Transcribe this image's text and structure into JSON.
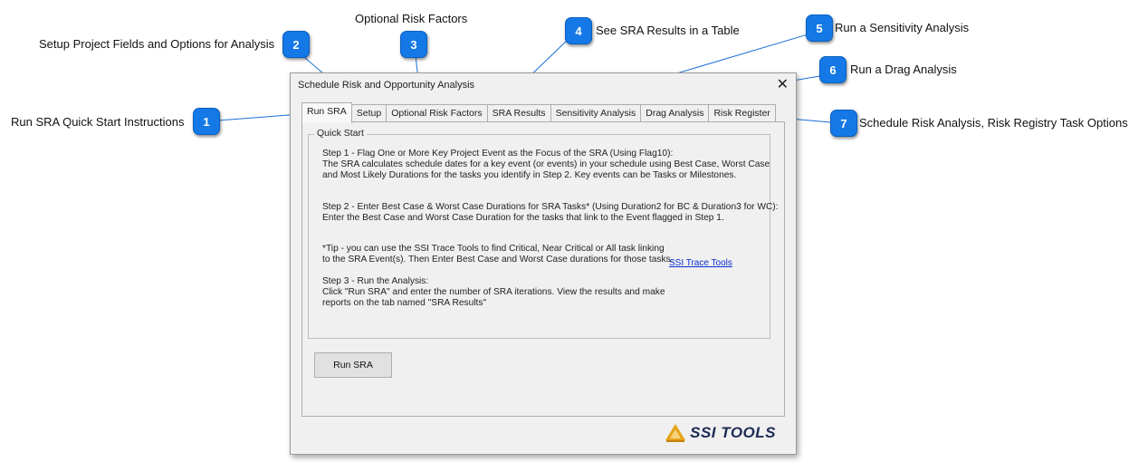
{
  "callouts": [
    {
      "num": "1",
      "text": "Run SRA Quick Start Instructions"
    },
    {
      "num": "2",
      "text": "Setup Project Fields and Options for Analysis"
    },
    {
      "num": "3",
      "text": "Optional Risk Factors"
    },
    {
      "num": "4",
      "text": "See SRA Results in a Table"
    },
    {
      "num": "5",
      "text": "Run a Sensitivity Analysis"
    },
    {
      "num": "6",
      "text": "Run a Drag Analysis"
    },
    {
      "num": "7",
      "text": "Schedule Risk Analysis, Risk Registry Task Options"
    }
  ],
  "dialog": {
    "title": "Schedule Risk and Opportunity Analysis",
    "close": "✕",
    "tabs": [
      "Run SRA",
      "Setup",
      "Optional Risk Factors",
      "SRA Results",
      "Sensitivity Analysis",
      "Drag Analysis",
      "Risk Register"
    ],
    "group_title": "Quick Start",
    "step1": [
      "Step 1 - Flag One or More Key Project Event as the Focus of the SRA (Using Flag10):",
      "The SRA calculates schedule dates for a key event (or events) in your schedule using Best Case, Worst Case",
      "and Most Likely Durations for the tasks you identify in Step 2.  Key events can be Tasks or Milestones."
    ],
    "step2": [
      "Step 2 - Enter Best Case & Worst Case Durations for SRA Tasks* (Using Duration2 for BC & Duration3 for WC):",
      "Enter the Best Case and Worst Case Duration for the tasks that link to the Event flagged in Step 1."
    ],
    "tip": [
      "*Tip - you can use the SSI Trace Tools to find Critical, Near Critical or All task linking",
      "to the SRA Event(s).  Then Enter Best Case and Worst Case durations for those tasks."
    ],
    "trace_link": "SSI Trace Tools",
    "step3": [
      "Step 3 - Run the Analysis:",
      "Click \"Run SRA\" and enter the number of SRA iterations.  View the results and make",
      "reports on the tab named \"SRA Results\""
    ],
    "run_button": "Run SRA",
    "brand": "SSI TOOLS"
  },
  "colors": {
    "badge": "#1479e6",
    "brand": "#1e2a55",
    "logo": "#e6a21a",
    "link": "#0b2fd1"
  }
}
